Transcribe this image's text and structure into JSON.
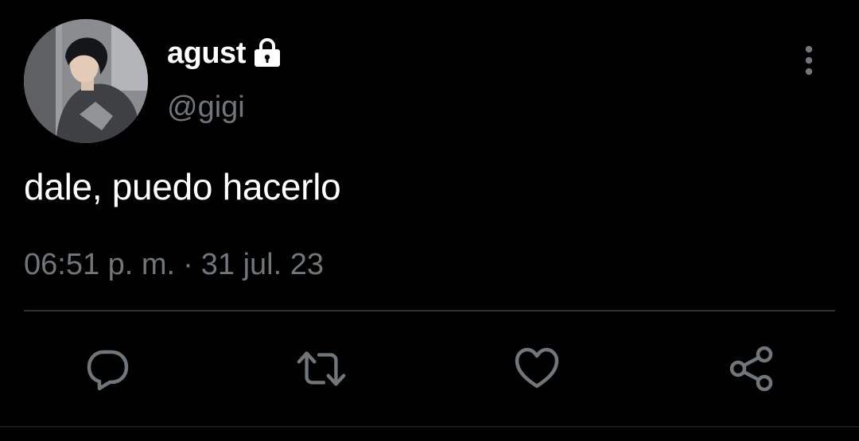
{
  "user": {
    "display_name": "agust",
    "handle": "@gigi",
    "protected_icon": "lock-icon",
    "avatar_icon": "profile-photo"
  },
  "tweet": {
    "text": "dale, puedo hacerlo",
    "time": "06:51 p. m.",
    "separator": "·",
    "date": "31 jul. 23"
  },
  "actions": [
    {
      "icon": "reply-icon"
    },
    {
      "icon": "retweet-icon"
    },
    {
      "icon": "like-icon"
    },
    {
      "icon": "share-icon"
    }
  ],
  "colors": {
    "background": "#000000",
    "primary_text": "#ffffff",
    "secondary_text": "#71767b",
    "divider": "#2f3336",
    "icon": "#71767b"
  }
}
